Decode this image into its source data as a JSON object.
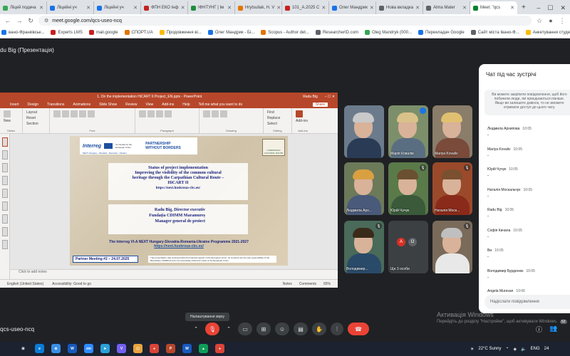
{
  "browser": {
    "tabs": [
      {
        "label": "Ліцей подача",
        "color": "#34a853"
      },
      {
        "label": "Ліцейні уч",
        "color": "#1a73e8"
      },
      {
        "label": "Ліцейні уч",
        "color": "#1a73e8"
      },
      {
        "label": "ФПН ЕКО Інф",
        "color": "#c5221f"
      },
      {
        "label": "ІФНТУНГ | Ім",
        "color": "#1e8e3e"
      },
      {
        "label": "Hrytsuliak, H. V",
        "color": "#e37400"
      },
      {
        "label": "101_A.2025 C",
        "color": "#c5221f"
      },
      {
        "label": "Олег Мандрик",
        "color": "#1a73e8"
      },
      {
        "label": "Нова вкладка",
        "color": "#5f6368"
      },
      {
        "label": "Alma Mater",
        "color": "#5f6368"
      },
      {
        "label": "Meet: \"qcs",
        "color": "#00832d",
        "active": true
      }
    ],
    "new_tab": "+",
    "window_controls": [
      "–",
      "☐",
      "✕"
    ],
    "url": "meet.google.com/qcs-useo-ncq",
    "bookmarks": [
      {
        "label": "вано-Франківськ...",
        "color": "#1a73e8"
      },
      {
        "label": "Experts LMS",
        "color": "#c5221f"
      },
      {
        "label": "mail.google",
        "color": "#c5221f"
      },
      {
        "label": "СПОРТ.UA",
        "color": "#e37400"
      },
      {
        "label": "Продовження ві...",
        "color": "#fbbc04"
      },
      {
        "label": "Олег Мандрик - Бі...",
        "color": "#1a73e8"
      },
      {
        "label": "Scopus - Author det...",
        "color": "#e37400"
      },
      {
        "label": "ResearcherID.com",
        "color": "#5f6368"
      },
      {
        "label": "Oleg Mandryk (000...",
        "color": "#34a853"
      },
      {
        "label": "Перекладач Google",
        "color": "#1a73e8"
      },
      {
        "label": "Сайт міста Івано-Ф...",
        "color": "#5f6368"
      },
      {
        "label": "Анкетування студе...",
        "color": "#fbbc04"
      }
    ]
  },
  "meet": {
    "presenter_title": "du Big (Презентація)",
    "code": "qcs-useo-ncq",
    "tooltip": "Налаштування звуку",
    "badge_count": "52"
  },
  "powerpoint": {
    "title": "1. On the implementation HiCART II Project_EN.pptx - PowerPoint",
    "user": "Radu Big",
    "menu": [
      "Insert",
      "Design",
      "Transitions",
      "Animations",
      "Slide Show",
      "Review",
      "View",
      "Add-ins",
      "Help"
    ],
    "search": "Tell me what you want to do",
    "share": "Share",
    "ribbon_groups": [
      "Slides",
      "Font",
      "Paragraph",
      "Drawing",
      "Editing",
      "Add-ins"
    ],
    "ribbon_labels": {
      "layout": "Layout",
      "reset": "Reset",
      "section": "Section",
      "new": "New",
      "find": "Find",
      "replace": "Replace",
      "select": "Select",
      "addins": "Add-ins"
    },
    "notes": "Click to add notes",
    "status_lang": "English (United States)",
    "status_access": "Accessibility: Good to go",
    "status_notes": "Notes",
    "status_comments": "Comments",
    "zoom": "65%"
  },
  "slide": {
    "interreg": "Interreg",
    "eu_text": "Co-funded by the European Union",
    "next": "NEXT Hungary - Slovakia - Romania - Ukraine",
    "partnership": "PARTNERSHIP",
    "without_borders": "WITHOUT BORDERS",
    "badge": "CARPATHIAN CULTURAL ROUTE",
    "status_title": "Status of project implementation",
    "improving": "Improving the visibility of the common cultural",
    "heritage": "heritage through the Carpathian Cultural Route –",
    "hicart": "HiCART II",
    "link": "https://next.huskroua-cbc.eu/",
    "speaker": "Radu Big, Director executiv",
    "org": "Fundația CDIMM Maramureș",
    "role": "Manager general de proiect",
    "programme": "The Interreg VI-A NEXT Hungary-Slovakia-Romania-Ukraine Programme 2021-2027",
    "programme_url": "https://next.huskroua-cbc.eu/",
    "partner_meeting": "Partner Meeting #2 – 24.07.2025",
    "disclaimer": "This presentation was produced with the financial support of the European Union. Its contents are the sole responsibility of the Beneficiary CDIMM and do not necessarily reflect the views of the European Union."
  },
  "participants": [
    {
      "name": "",
      "muted": false,
      "bg": "#6b7b8c",
      "hair": "#c9c9c9",
      "shirt": "#2a3b55"
    },
    {
      "name": "Марія Ковалів",
      "muted": false,
      "speaking": true,
      "bg": "#7c8f6a",
      "hair": "#d9c28a",
      "shirt": "#5a6e82"
    },
    {
      "name": "Mariya Kovaliv",
      "muted": false,
      "bg": "#8a7d6a",
      "hair": "#e0c070",
      "shirt": "#7a4a3a"
    },
    {
      "name": "Людмила Арх...",
      "muted": false,
      "bg": "#6c7a5a",
      "hair": "#d8a040",
      "shirt": "#4a5a7a"
    },
    {
      "name": "Юрій Чучук",
      "muted": true,
      "bg": "#5a7a4a",
      "hair": "#6a5030",
      "shirt": "#3a5a3a"
    },
    {
      "name": "Наталія Моск...",
      "muted": true,
      "bg": "#9a4a2a",
      "hair": "#7a5030",
      "shirt": "#8a2a1a"
    },
    {
      "name": "Володимир...",
      "muted": true,
      "bg": "#4a6a5a",
      "hair": "#3a2a1a",
      "shirt": "#2a4a6a"
    },
    {
      "name": "Ще 3 особи",
      "muted": false,
      "others": true
    },
    {
      "name": "",
      "muted": true,
      "bg": "#7a6a5a",
      "hair": "#bfbfbf",
      "shirt": "#e8e8e8"
    }
  ],
  "others_avatars": [
    {
      "letter": "A",
      "color": "#d93025"
    },
    {
      "letter": "O",
      "color": "#5f6368"
    }
  ],
  "chat": {
    "title": "Чат під час зустрічі",
    "info": "Ви можете закріпити повідомлення, щоб його побачили люди, які приєднаються пізніше. Якщо ви залишите дзвінок, то не зможете отримати доступ до цього чату.",
    "messages": [
      {
        "name": "Людмила Архипова",
        "time": "10:05",
        "text": "-"
      },
      {
        "name": "Mariya Kovaliv",
        "time": "10:05",
        "text": "-"
      },
      {
        "name": "Юрій Чучук",
        "time": "10:05",
        "text": "-"
      },
      {
        "name": "Наталія Москальчук",
        "time": "10:05",
        "text": "-"
      },
      {
        "name": "Radu Big",
        "time": "10:05",
        "text": "-"
      },
      {
        "name": "Софія Качала",
        "time": "10:05",
        "text": "-"
      },
      {
        "name": "Ви",
        "time": "10:05",
        "text": "-"
      },
      {
        "name": "Володимир Бурденюк",
        "time": "10:05",
        "text": "-"
      },
      {
        "name": "Angela Muresan",
        "time": "10:06",
        "text": ""
      }
    ],
    "input_placeholder": "Надіслати повідомлення"
  },
  "watermark": {
    "line1": "Активація Windows",
    "line2": "Перейдіть до розділу \"Настройки\", щоб активувати Windows."
  },
  "taskbar": {
    "apps": [
      {
        "label": "⊞",
        "color": "#1c2230"
      },
      {
        "label": "e",
        "color": "#0a7cd6"
      },
      {
        "label": "⊚",
        "color": "#3a8ee6"
      },
      {
        "label": "W",
        "color": "#185abd"
      },
      {
        "label": "zm",
        "color": "#2d8cff"
      },
      {
        "label": "➤",
        "color": "#2aa1d9"
      },
      {
        "label": "V",
        "color": "#7360f2"
      },
      {
        "label": "⬡",
        "color": "#e8a33d"
      },
      {
        "label": "●",
        "color": "#db4437"
      },
      {
        "label": "P",
        "color": "#b7472a"
      },
      {
        "label": "W",
        "color": "#185abd"
      },
      {
        "label": "▲",
        "color": "#0f9d58"
      },
      {
        "label": "●",
        "color": "#db4437"
      }
    ],
    "weather": "22°C Sunny",
    "lang": "ENG",
    "time": "24"
  }
}
